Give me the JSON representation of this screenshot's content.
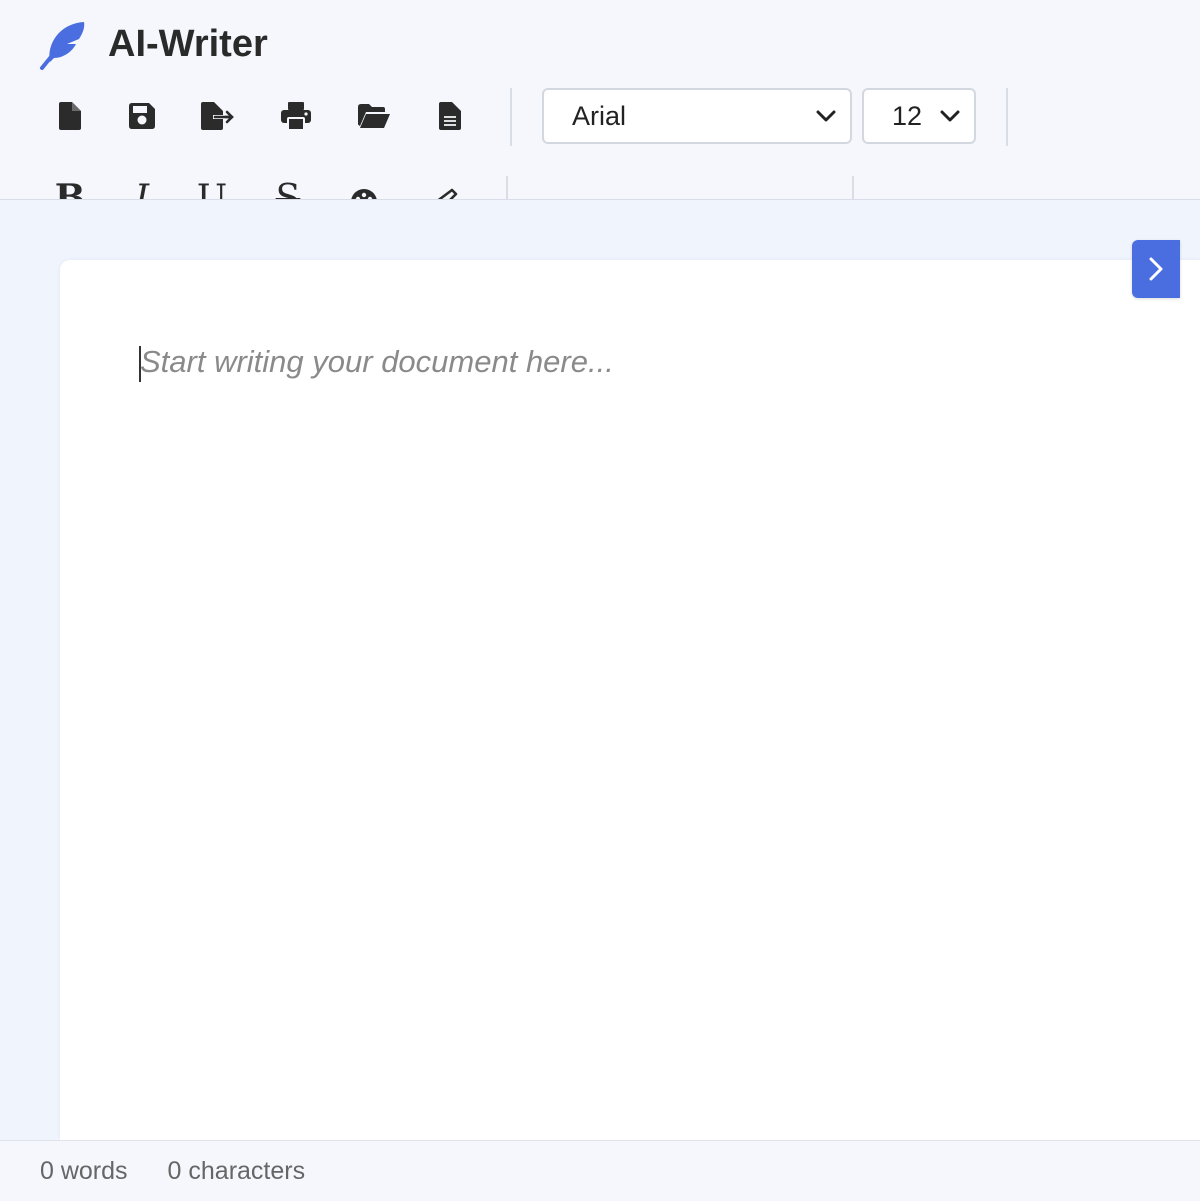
{
  "app": {
    "title": "AI-Writer",
    "accent_color": "#4a6ee0",
    "logo_icon": "feather-icon"
  },
  "file_toolbar": [
    {
      "name": "new-document-button",
      "icon": "new-file-icon"
    },
    {
      "name": "save-button",
      "icon": "save-icon"
    },
    {
      "name": "export-button",
      "icon": "export-icon"
    },
    {
      "name": "print-button",
      "icon": "print-icon"
    },
    {
      "name": "open-folder-button",
      "icon": "folder-open-icon"
    },
    {
      "name": "document-button",
      "icon": "document-lines-icon"
    }
  ],
  "font": {
    "family_selected": "Arial",
    "size_selected": "12"
  },
  "format_toolbar": [
    {
      "name": "bold-button",
      "label": "B"
    },
    {
      "name": "italic-button",
      "label": "I"
    },
    {
      "name": "underline-button",
      "label": "U"
    },
    {
      "name": "strikethrough-button",
      "label": "S"
    },
    {
      "name": "text-color-button",
      "icon": "palette-icon"
    },
    {
      "name": "highlight-button",
      "icon": "highlighter-icon"
    }
  ],
  "align_toolbar": [
    {
      "name": "align-left-button",
      "icon": "align-left-icon"
    },
    {
      "name": "align-center-button",
      "icon": "align-center-icon"
    },
    {
      "name": "align-right-button",
      "icon": "align-right-icon"
    },
    {
      "name": "align-justify-button",
      "icon": "align-justify-icon"
    }
  ],
  "editor": {
    "placeholder": "Start writing your document here..."
  },
  "sidebar_toggle": {
    "icon": "chevron-right-icon"
  },
  "status": {
    "words": "0 words",
    "characters": "0 characters"
  }
}
